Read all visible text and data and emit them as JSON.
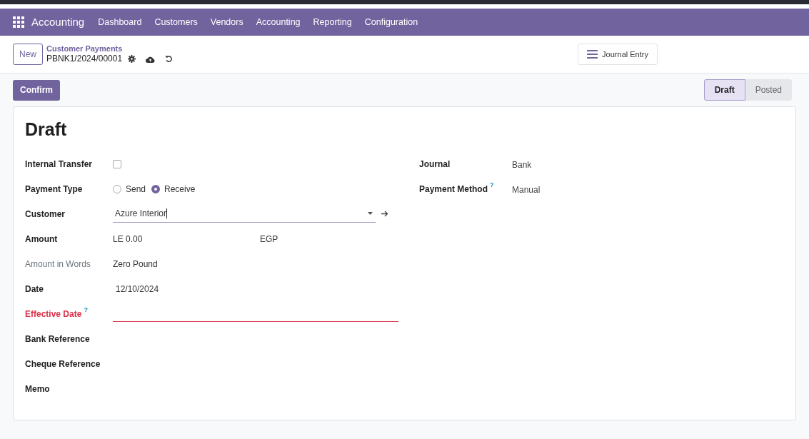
{
  "navbar": {
    "app": "Accounting",
    "menu": [
      "Dashboard",
      "Customers",
      "Vendors",
      "Accounting",
      "Reporting",
      "Configuration"
    ]
  },
  "control_panel": {
    "new_button": "New",
    "breadcrumb": "Customer Payments",
    "record": "PBNK1/2024/00001",
    "smart_button": "Journal Entry"
  },
  "action_bar": {
    "confirm_button": "Confirm",
    "statuses": [
      {
        "label": "Draft",
        "selected": true
      },
      {
        "label": "Posted",
        "selected": false
      }
    ]
  },
  "form": {
    "title": "Draft",
    "left_fields": [
      {
        "kind": "checkbox",
        "label": "Internal Transfer",
        "checked": false
      },
      {
        "kind": "radio",
        "label": "Payment Type",
        "options": [
          {
            "label": "Send",
            "selected": false
          },
          {
            "label": "Receive",
            "selected": true
          }
        ]
      },
      {
        "kind": "many2one",
        "label": "Customer",
        "value": "Azure Interior"
      },
      {
        "kind": "monetary",
        "label": "Amount",
        "value": "LE 0.00",
        "currency": "EGP"
      },
      {
        "kind": "readonly",
        "label": "Amount in Words",
        "value": "Zero Pound"
      },
      {
        "kind": "text",
        "label": "Date",
        "value": "12/10/2024"
      },
      {
        "kind": "required",
        "label": "Effective Date",
        "help": "?"
      },
      {
        "kind": "empty",
        "label": "Bank Reference"
      },
      {
        "kind": "empty",
        "label": "Cheque Reference"
      },
      {
        "kind": "empty",
        "label": "Memo"
      }
    ],
    "right_fields": [
      {
        "label": "Journal",
        "value": "Bank"
      },
      {
        "label": "Payment Method",
        "help": "?",
        "value": "Manual"
      }
    ]
  }
}
